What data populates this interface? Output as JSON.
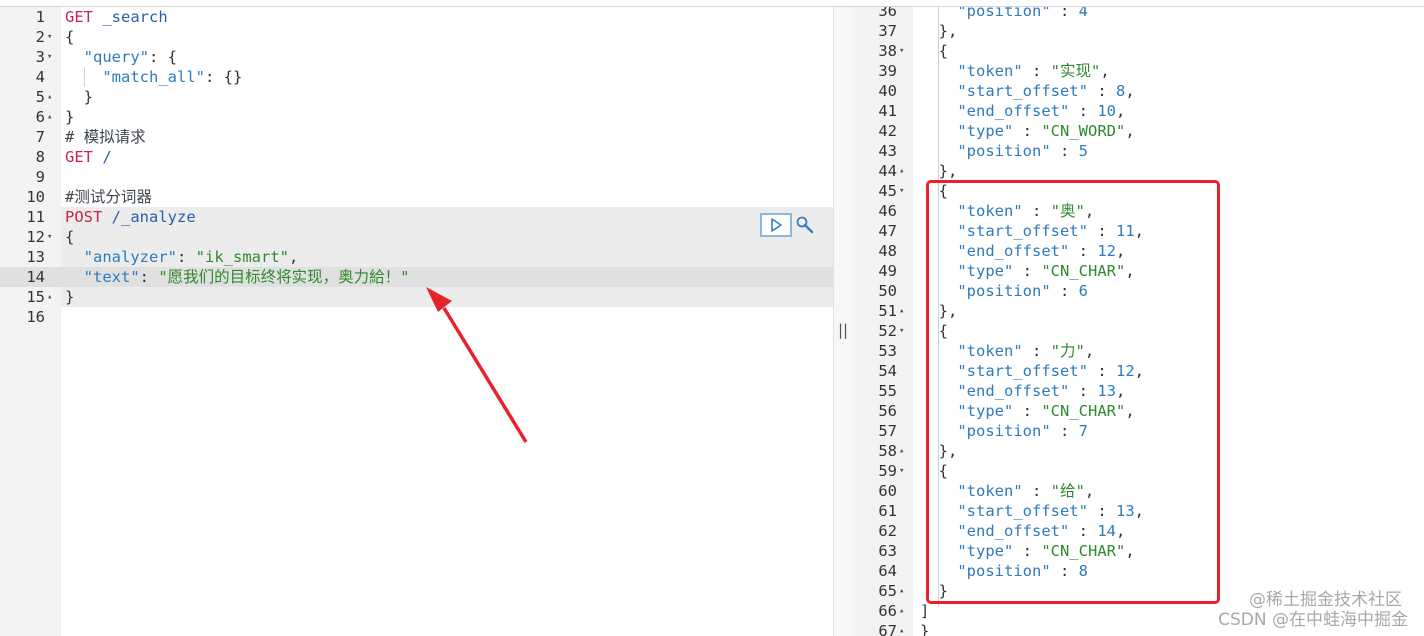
{
  "request_lines": [
    {
      "no": "1",
      "fold": "",
      "segs": [
        {
          "t": "GET",
          "c": "m"
        },
        {
          "t": " _search",
          "c": "u"
        }
      ]
    },
    {
      "no": "2",
      "fold": "▾",
      "segs": [
        {
          "t": "{",
          "c": "p"
        }
      ]
    },
    {
      "no": "3",
      "fold": "▾",
      "segs": [
        {
          "t": "  ",
          "c": "p"
        },
        {
          "t": "\"query\"",
          "c": "k"
        },
        {
          "t": ": {",
          "c": "p"
        }
      ]
    },
    {
      "no": "4",
      "fold": "",
      "segs": [
        {
          "t": "    ",
          "c": "p"
        },
        {
          "t": "\"match_all\"",
          "c": "k"
        },
        {
          "t": ": {}",
          "c": "p"
        }
      ]
    },
    {
      "no": "5",
      "fold": "▴",
      "segs": [
        {
          "t": "  }",
          "c": "p"
        }
      ]
    },
    {
      "no": "6",
      "fold": "▴",
      "segs": [
        {
          "t": "}",
          "c": "p"
        }
      ]
    },
    {
      "no": "7",
      "fold": "",
      "segs": [
        {
          "t": "# 模拟请求",
          "c": "c"
        }
      ]
    },
    {
      "no": "8",
      "fold": "",
      "segs": [
        {
          "t": "GET",
          "c": "m"
        },
        {
          "t": " /",
          "c": "u"
        }
      ]
    },
    {
      "no": "9",
      "fold": "",
      "segs": []
    },
    {
      "no": "10",
      "fold": "",
      "segs": [
        {
          "t": "#测试分词器",
          "c": "c"
        }
      ]
    },
    {
      "no": "11",
      "fold": "",
      "segs": [
        {
          "t": "POST",
          "c": "m"
        },
        {
          "t": " /_analyze",
          "c": "u"
        }
      ]
    },
    {
      "no": "12",
      "fold": "▾",
      "segs": [
        {
          "t": "{",
          "c": "p"
        }
      ]
    },
    {
      "no": "13",
      "fold": "",
      "segs": [
        {
          "t": "  ",
          "c": "p"
        },
        {
          "t": "\"analyzer\"",
          "c": "k"
        },
        {
          "t": ": ",
          "c": "p"
        },
        {
          "t": "\"ik_smart\"",
          "c": "s"
        },
        {
          "t": ",",
          "c": "p"
        }
      ]
    },
    {
      "no": "14",
      "fold": "",
      "segs": [
        {
          "t": "  ",
          "c": "p"
        },
        {
          "t": "\"text\"",
          "c": "k"
        },
        {
          "t": ": ",
          "c": "p"
        },
        {
          "t": "\"愿我们的目标终将实现，奥力給！\"",
          "c": "s"
        }
      ]
    },
    {
      "no": "15",
      "fold": "▴",
      "segs": [
        {
          "t": "}",
          "c": "p"
        }
      ]
    },
    {
      "no": "16",
      "fold": "",
      "segs": []
    }
  ],
  "response_lines": [
    {
      "no": "36",
      "fold": "",
      "segs": [
        {
          "t": "    ",
          "c": "p"
        },
        {
          "t": "\"position\"",
          "c": "k"
        },
        {
          "t": " : ",
          "c": "p"
        },
        {
          "t": "4",
          "c": "n"
        }
      ]
    },
    {
      "no": "37",
      "fold": "",
      "segs": [
        {
          "t": "  },",
          "c": "p"
        }
      ]
    },
    {
      "no": "38",
      "fold": "▾",
      "segs": [
        {
          "t": "  {",
          "c": "p"
        }
      ]
    },
    {
      "no": "39",
      "fold": "",
      "segs": [
        {
          "t": "    ",
          "c": "p"
        },
        {
          "t": "\"token\"",
          "c": "k"
        },
        {
          "t": " : ",
          "c": "p"
        },
        {
          "t": "\"实现\"",
          "c": "s"
        },
        {
          "t": ",",
          "c": "p"
        }
      ]
    },
    {
      "no": "40",
      "fold": "",
      "segs": [
        {
          "t": "    ",
          "c": "p"
        },
        {
          "t": "\"start_offset\"",
          "c": "k"
        },
        {
          "t": " : ",
          "c": "p"
        },
        {
          "t": "8",
          "c": "n"
        },
        {
          "t": ",",
          "c": "p"
        }
      ]
    },
    {
      "no": "41",
      "fold": "",
      "segs": [
        {
          "t": "    ",
          "c": "p"
        },
        {
          "t": "\"end_offset\"",
          "c": "k"
        },
        {
          "t": " : ",
          "c": "p"
        },
        {
          "t": "10",
          "c": "n"
        },
        {
          "t": ",",
          "c": "p"
        }
      ]
    },
    {
      "no": "42",
      "fold": "",
      "segs": [
        {
          "t": "    ",
          "c": "p"
        },
        {
          "t": "\"type\"",
          "c": "k"
        },
        {
          "t": " : ",
          "c": "p"
        },
        {
          "t": "\"CN_WORD\"",
          "c": "s"
        },
        {
          "t": ",",
          "c": "p"
        }
      ]
    },
    {
      "no": "43",
      "fold": "",
      "segs": [
        {
          "t": "    ",
          "c": "p"
        },
        {
          "t": "\"position\"",
          "c": "k"
        },
        {
          "t": " : ",
          "c": "p"
        },
        {
          "t": "5",
          "c": "n"
        }
      ]
    },
    {
      "no": "44",
      "fold": "▴",
      "segs": [
        {
          "t": "  },",
          "c": "p"
        }
      ]
    },
    {
      "no": "45",
      "fold": "▾",
      "segs": [
        {
          "t": "  {",
          "c": "p"
        }
      ]
    },
    {
      "no": "46",
      "fold": "",
      "segs": [
        {
          "t": "    ",
          "c": "p"
        },
        {
          "t": "\"token\"",
          "c": "k"
        },
        {
          "t": " : ",
          "c": "p"
        },
        {
          "t": "\"奥\"",
          "c": "s"
        },
        {
          "t": ",",
          "c": "p"
        }
      ]
    },
    {
      "no": "47",
      "fold": "",
      "segs": [
        {
          "t": "    ",
          "c": "p"
        },
        {
          "t": "\"start_offset\"",
          "c": "k"
        },
        {
          "t": " : ",
          "c": "p"
        },
        {
          "t": "11",
          "c": "n"
        },
        {
          "t": ",",
          "c": "p"
        }
      ]
    },
    {
      "no": "48",
      "fold": "",
      "segs": [
        {
          "t": "    ",
          "c": "p"
        },
        {
          "t": "\"end_offset\"",
          "c": "k"
        },
        {
          "t": " : ",
          "c": "p"
        },
        {
          "t": "12",
          "c": "n"
        },
        {
          "t": ",",
          "c": "p"
        }
      ]
    },
    {
      "no": "49",
      "fold": "",
      "segs": [
        {
          "t": "    ",
          "c": "p"
        },
        {
          "t": "\"type\"",
          "c": "k"
        },
        {
          "t": " : ",
          "c": "p"
        },
        {
          "t": "\"CN_CHAR\"",
          "c": "s"
        },
        {
          "t": ",",
          "c": "p"
        }
      ]
    },
    {
      "no": "50",
      "fold": "",
      "segs": [
        {
          "t": "    ",
          "c": "p"
        },
        {
          "t": "\"position\"",
          "c": "k"
        },
        {
          "t": " : ",
          "c": "p"
        },
        {
          "t": "6",
          "c": "n"
        }
      ]
    },
    {
      "no": "51",
      "fold": "▴",
      "segs": [
        {
          "t": "  },",
          "c": "p"
        }
      ]
    },
    {
      "no": "52",
      "fold": "▾",
      "segs": [
        {
          "t": "  {",
          "c": "p"
        }
      ]
    },
    {
      "no": "53",
      "fold": "",
      "segs": [
        {
          "t": "    ",
          "c": "p"
        },
        {
          "t": "\"token\"",
          "c": "k"
        },
        {
          "t": " : ",
          "c": "p"
        },
        {
          "t": "\"力\"",
          "c": "s"
        },
        {
          "t": ",",
          "c": "p"
        }
      ]
    },
    {
      "no": "54",
      "fold": "",
      "segs": [
        {
          "t": "    ",
          "c": "p"
        },
        {
          "t": "\"start_offset\"",
          "c": "k"
        },
        {
          "t": " : ",
          "c": "p"
        },
        {
          "t": "12",
          "c": "n"
        },
        {
          "t": ",",
          "c": "p"
        }
      ]
    },
    {
      "no": "55",
      "fold": "",
      "segs": [
        {
          "t": "    ",
          "c": "p"
        },
        {
          "t": "\"end_offset\"",
          "c": "k"
        },
        {
          "t": " : ",
          "c": "p"
        },
        {
          "t": "13",
          "c": "n"
        },
        {
          "t": ",",
          "c": "p"
        }
      ]
    },
    {
      "no": "56",
      "fold": "",
      "segs": [
        {
          "t": "    ",
          "c": "p"
        },
        {
          "t": "\"type\"",
          "c": "k"
        },
        {
          "t": " : ",
          "c": "p"
        },
        {
          "t": "\"CN_CHAR\"",
          "c": "s"
        },
        {
          "t": ",",
          "c": "p"
        }
      ]
    },
    {
      "no": "57",
      "fold": "",
      "segs": [
        {
          "t": "    ",
          "c": "p"
        },
        {
          "t": "\"position\"",
          "c": "k"
        },
        {
          "t": " : ",
          "c": "p"
        },
        {
          "t": "7",
          "c": "n"
        }
      ]
    },
    {
      "no": "58",
      "fold": "▴",
      "segs": [
        {
          "t": "  },",
          "c": "p"
        }
      ]
    },
    {
      "no": "59",
      "fold": "▾",
      "segs": [
        {
          "t": "  {",
          "c": "p"
        }
      ]
    },
    {
      "no": "60",
      "fold": "",
      "segs": [
        {
          "t": "    ",
          "c": "p"
        },
        {
          "t": "\"token\"",
          "c": "k"
        },
        {
          "t": " : ",
          "c": "p"
        },
        {
          "t": "\"给\"",
          "c": "s"
        },
        {
          "t": ",",
          "c": "p"
        }
      ]
    },
    {
      "no": "61",
      "fold": "",
      "segs": [
        {
          "t": "    ",
          "c": "p"
        },
        {
          "t": "\"start_offset\"",
          "c": "k"
        },
        {
          "t": " : ",
          "c": "p"
        },
        {
          "t": "13",
          "c": "n"
        },
        {
          "t": ",",
          "c": "p"
        }
      ]
    },
    {
      "no": "62",
      "fold": "",
      "segs": [
        {
          "t": "    ",
          "c": "p"
        },
        {
          "t": "\"end_offset\"",
          "c": "k"
        },
        {
          "t": " : ",
          "c": "p"
        },
        {
          "t": "14",
          "c": "n"
        },
        {
          "t": ",",
          "c": "p"
        }
      ]
    },
    {
      "no": "63",
      "fold": "",
      "segs": [
        {
          "t": "    ",
          "c": "p"
        },
        {
          "t": "\"type\"",
          "c": "k"
        },
        {
          "t": " : ",
          "c": "p"
        },
        {
          "t": "\"CN_CHAR\"",
          "c": "s"
        },
        {
          "t": ",",
          "c": "p"
        }
      ]
    },
    {
      "no": "64",
      "fold": "",
      "segs": [
        {
          "t": "    ",
          "c": "p"
        },
        {
          "t": "\"position\"",
          "c": "k"
        },
        {
          "t": " : ",
          "c": "p"
        },
        {
          "t": "8",
          "c": "n"
        }
      ]
    },
    {
      "no": "65",
      "fold": "▴",
      "segs": [
        {
          "t": "  }",
          "c": "p"
        }
      ]
    },
    {
      "no": "66",
      "fold": "▴",
      "segs": [
        {
          "t": "]",
          "c": "p"
        }
      ]
    },
    {
      "no": "67",
      "fold": "▴",
      "segs": [
        {
          "t": "}",
          "c": "p"
        }
      ]
    }
  ],
  "divider_glyph": "||",
  "watermark_line1": "@稀土掘金技术社区",
  "watermark_line2": "CSDN @在中蛙海中掘金",
  "colors": {
    "highlight_box": "#e8222a",
    "method": "#c7254e",
    "key": "#2e7bbf",
    "string": "#2f8a2f"
  },
  "icons": {
    "run": "play-icon",
    "settings": "wrench-icon"
  }
}
